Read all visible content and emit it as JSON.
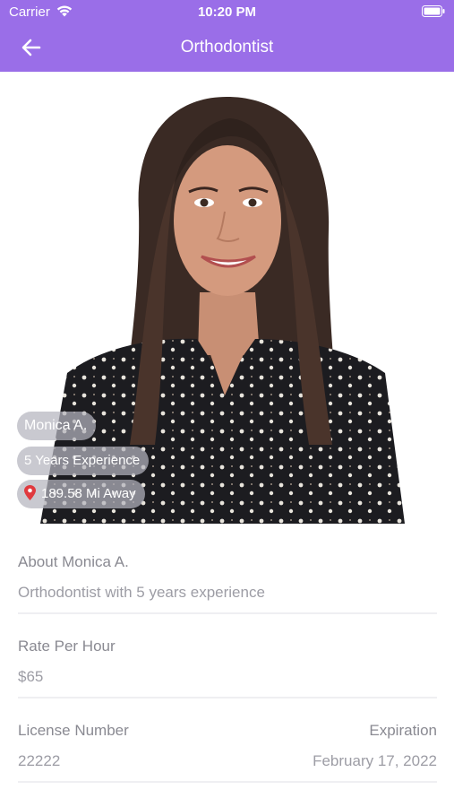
{
  "status_bar": {
    "carrier": "Carrier",
    "time": "10:20 PM"
  },
  "header": {
    "title": "Orthodontist"
  },
  "profile": {
    "name": "Monica A.",
    "experience": "5 Years Experience",
    "distance": "189.58 Mi Away"
  },
  "about": {
    "label": "About Monica A.",
    "value": "Orthodontist with 5 years experience"
  },
  "rate": {
    "label": "Rate Per Hour",
    "value": "$65"
  },
  "license": {
    "label": "License Number",
    "value": "22222"
  },
  "expiration": {
    "label": "Expiration",
    "value": "February 17, 2022"
  },
  "colors": {
    "accent": "#9a6ee8",
    "pin": "#e0393e"
  },
  "icons": {
    "back": "arrow-left-icon",
    "wifi": "wifi-icon",
    "battery": "battery-icon",
    "pin": "map-pin-icon"
  }
}
